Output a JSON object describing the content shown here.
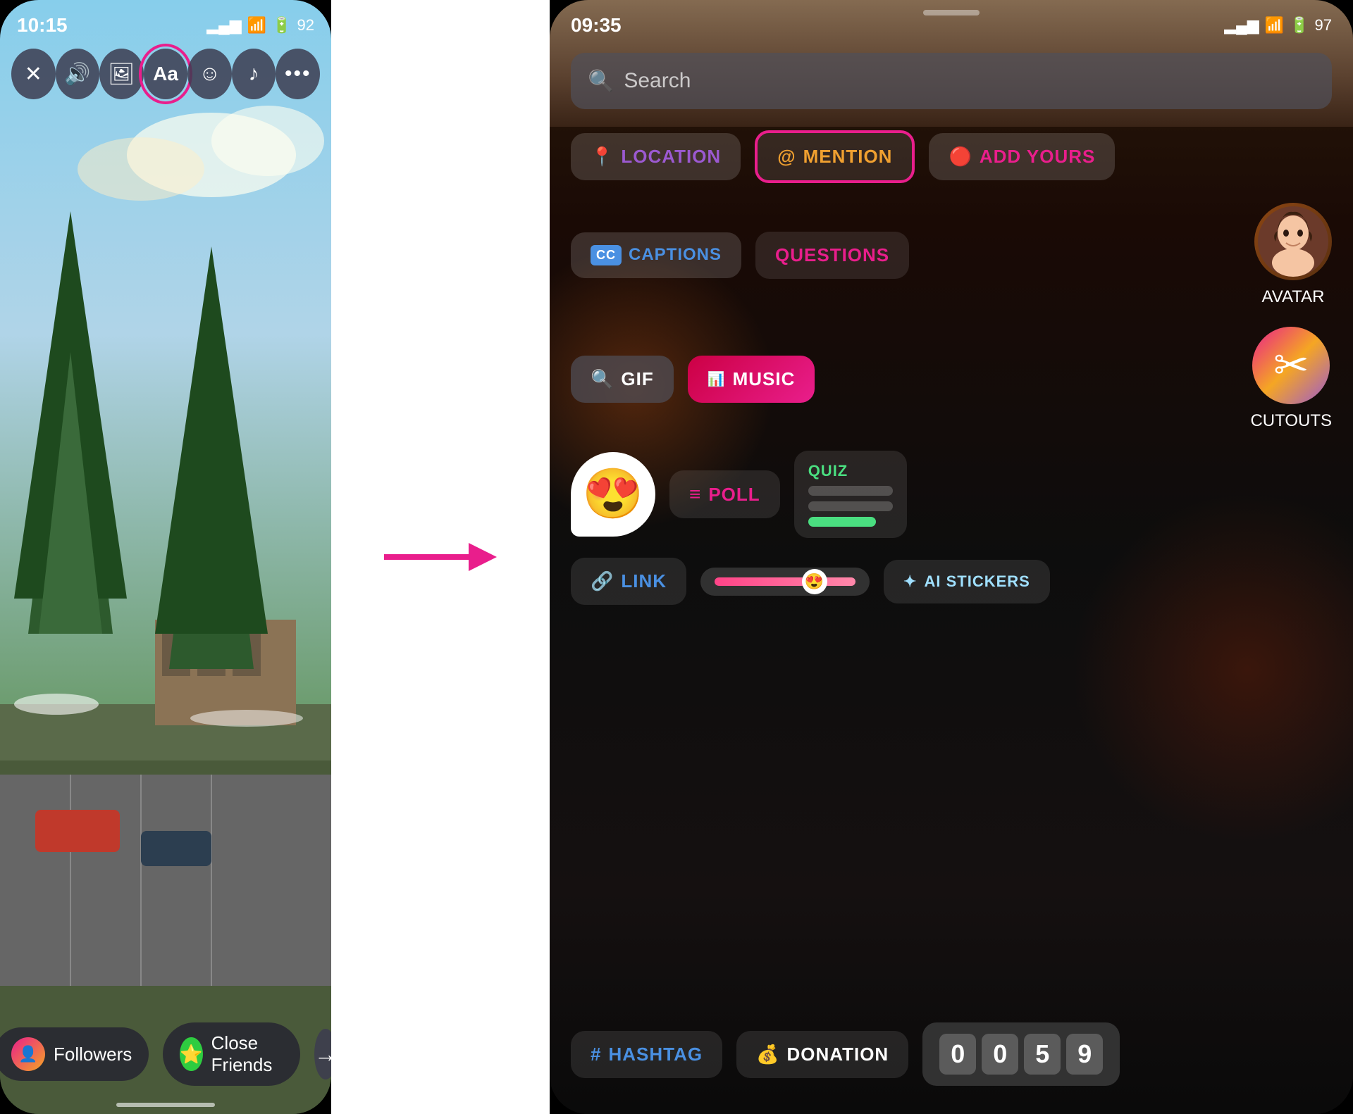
{
  "left": {
    "time": "10:15",
    "signal": "▂▄▆",
    "wifi": "WiFi",
    "battery": "92",
    "toolbar": {
      "close_label": "✕",
      "sound_label": "🔊",
      "gallery_label": "🖼",
      "text_label": "Aa",
      "sticker_label": "☺",
      "music_label": "♪",
      "more_label": "•••"
    },
    "bottom": {
      "followers_label": "Followers",
      "close_friends_label": "Close Friends",
      "arrow_label": "→"
    }
  },
  "right": {
    "time": "09:35",
    "signal": "▂▄▆",
    "wifi": "WiFi",
    "battery": "97",
    "search_placeholder": "Search",
    "stickers": {
      "row1": [
        {
          "id": "location",
          "label": "LOCATION",
          "icon": "📍"
        },
        {
          "id": "mention",
          "label": "@MENTION",
          "icon": "@",
          "highlighted": true
        },
        {
          "id": "add-yours",
          "label": "ADD YOURS",
          "icon": "🔴"
        }
      ],
      "row2": [
        {
          "id": "captions",
          "label": "CAPTIONS",
          "icon": "CC"
        },
        {
          "id": "questions",
          "label": "QUESTIONS",
          "icon": ""
        }
      ],
      "row2_right": [
        {
          "id": "avatar",
          "label": "AVATAR"
        }
      ],
      "row3": [
        {
          "id": "gif",
          "label": "GIF",
          "icon": "🔍"
        },
        {
          "id": "music",
          "label": "MUSIC",
          "icon": "📊"
        }
      ],
      "row3_right": [
        {
          "id": "cutouts",
          "label": "CUTOUTS"
        }
      ],
      "row4": [
        {
          "id": "emoji-reaction",
          "label": "😍"
        },
        {
          "id": "poll",
          "label": "POLL",
          "icon": "≡"
        },
        {
          "id": "quiz",
          "label": "QUIZ"
        }
      ],
      "row5": [
        {
          "id": "link",
          "label": "LINK",
          "icon": "🔗"
        },
        {
          "id": "emoji-slider",
          "label": "😍"
        },
        {
          "id": "ai-stickers",
          "label": "AI STICKERS",
          "icon": "✦"
        }
      ],
      "row6": [
        {
          "id": "hashtag",
          "label": "#HASHTAG"
        },
        {
          "id": "donation",
          "label": "DONATION"
        },
        {
          "id": "countdown",
          "d1": "0",
          "d2": "0",
          "d3": "5",
          "d4": "9"
        }
      ]
    }
  },
  "arrow": "→"
}
